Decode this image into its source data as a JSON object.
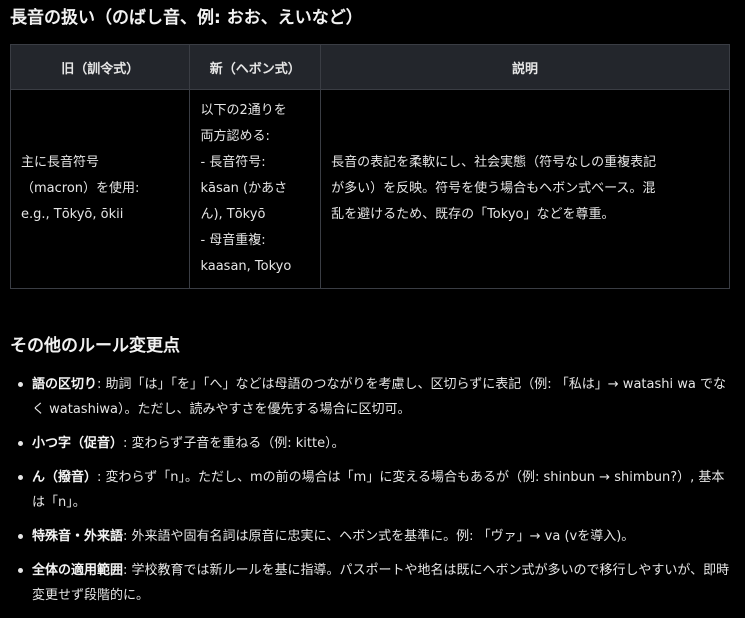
{
  "section1": {
    "heading": "長音の扱い（のばし音、例: おお、えいなど）"
  },
  "table": {
    "headers": [
      "旧（訓令式）",
      "新（ヘボン式）",
      "説明"
    ],
    "row": {
      "old": [
        "主に長音符号",
        "（macron）を使用:",
        "e.g., Tōkyō, ōkii"
      ],
      "new": [
        "以下の2通りを",
        "両方認める:",
        "- 長音符号:",
        "kāsan (かあさ",
        "ん), Tōkyō",
        "- 母音重複:",
        "kaasan, Tokyo"
      ],
      "desc": [
        "長音の表記を柔軟にし、社会実態（符号なしの重複表記",
        "が多い）を反映。符号を使う場合もヘボン式ベース。混",
        "乱を避けるため、既存の「Tokyo」などを尊重。"
      ]
    }
  },
  "section2": {
    "heading": "その他のルール変更点",
    "items": [
      {
        "term": "語の区切り",
        "text": ": 助詞「は」「を」「へ」などは母語のつながりを考慮し、区切らずに表記（例: 「私は」→ watashi wa でなく watashiwa）。ただし、読みやすさを優先する場合に区切可。"
      },
      {
        "term": "小つ字（促音）",
        "text": ": 変わらず子音を重ねる（例: kitte）。"
      },
      {
        "term": "ん（撥音）",
        "text": ": 変わらず「n」。ただし、mの前の場合は「m」に変える場合もあるが（例: shinbun → shimbun?）, 基本は「n」。"
      },
      {
        "term": "特殊音・外来語",
        "text": ": 外来語や固有名詞は原音に忠実に、ヘボン式を基準に。例: 「ヴァ」→ va (vを導入)。"
      },
      {
        "term": "全体の適用範囲",
        "text": ": 学校教育では新ルールを基に指導。パスポートや地名は既にヘボン式が多いので移行しやすいが、即時変更せず段階的に。"
      }
    ]
  }
}
